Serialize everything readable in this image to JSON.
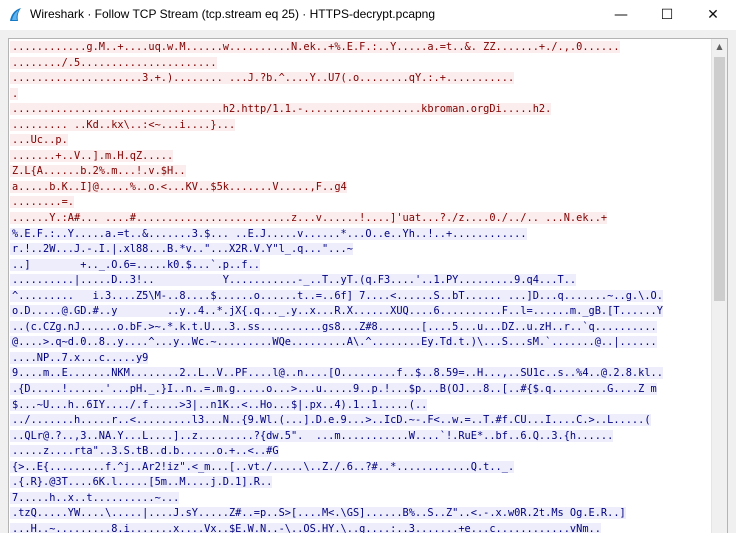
{
  "window": {
    "title": "Wireshark · Follow TCP Stream (tcp.stream eq 25) · HTTPS-decrypt.pcapng",
    "minimize_glyph": "—",
    "maximize_glyph": "☐",
    "close_glyph": "✕"
  },
  "icons": {
    "app": "wireshark-fin-icon",
    "scroll_up": "chevron-up-icon",
    "scroll_down": "chevron-down-icon"
  },
  "colors": {
    "client_text": "#7f0000",
    "client_bg": "#fbeded",
    "server_text": "#00007f",
    "server_bg": "#ededfb"
  },
  "stream": {
    "lines": [
      {
        "dir": "client",
        "text": "............g.M..+....uq.w.M......w..........N.ek..+%.E.F.:..Y.....a.=t..&. ZZ.......+./.,.0......"
      },
      {
        "dir": "client",
        "text": "......../.5......................"
      },
      {
        "dir": "client",
        "text": ".....................3.+.)........ ...J.?b.^....Y..U7(.o........qY.:.+..........."
      },
      {
        "dir": "client",
        "text": "."
      },
      {
        "dir": "client",
        "text": "..................................h2.http/1.1.-...................kbroman.orgDi.....h2."
      },
      {
        "dir": "client",
        "text": "......... ..Kd..kx\\..:<~...i....}..."
      },
      {
        "dir": "client",
        "text": "...Uc..p."
      },
      {
        "dir": "client",
        "text": ".......+..V..].m.H.qZ....."
      },
      {
        "dir": "client",
        "text": "Z.L{A......b.2%.m...!.v.$H.."
      },
      {
        "dir": "client",
        "text": "a.....b.K..I]@.....%..o.<...KV..$5k.......V.....,F..g4"
      },
      {
        "dir": "client",
        "text": "........=."
      },
      {
        "dir": "client",
        "text": "......Y.:A#... ....#.........................z...v......!....]'uat...?./z....0./../.. ...N.ek..+"
      },
      {
        "dir": "server",
        "text": "%.E.F.:..Y.....a.=t..&.......3.$... ..E.J.....v......*...O..e..Yh..!..+............"
      },
      {
        "dir": "server",
        "text": "r.!..2W...J.-.I.|.xl88...B.*v..\"...X2R.V.Y\"l_.q...\"...~"
      },
      {
        "dir": "server",
        "text": "..]        +.._.O.6=.....k0.$...`.p..f.."
      },
      {
        "dir": "server",
        "text": "..........|.....D..3!..           Y...........-_..T..yT.(q.F3....'..1.PY.........9.q4...T.."
      },
      {
        "dir": "server",
        "text": "^.........   i.3....Z5\\M-..8....$......o......t..=..6f] 7....<......S..bT...... ...]D...q.......~..g.\\.O."
      },
      {
        "dir": "server",
        "text": "o.D.....@.GD.#..y        ..y..4..*.jX{.q..._.y..x...R.X......XUQ....6..........F..l=......m._gB.[T......Y"
      },
      {
        "dir": "server",
        "text": "..(c.CZg.nJ......o.bF.>~.*.k.t.U...3..ss..........gs8...Z#8.......[....5...u...DZ..u.zH..r..`q.........."
      },
      {
        "dir": "server",
        "text": "@....>.q~d.0..8..y....^...y..Wc.~.........WQe.........A\\.^........Ey.Td.t.)\\...S...sM.`.......@..|......"
      },
      {
        "dir": "server",
        "text": "....NP..7.x...c.....y9"
      },
      {
        "dir": "server",
        "text": "9....m..E.......NKM........2..L..V..PF....l@..n....[O.........f..$..8.59=..H...,..SU1c..s..%4..@.2.8.kl.."
      },
      {
        "dir": "server",
        "text": ".{D.....!......'...pH._.}I..n..=.m.g.....o...>...u.....9..p.!...$p...B(OJ...8..[..#{$.q.........G....Z m"
      },
      {
        "dir": "server",
        "text": "$...~U...h..6IY..../.f.....>3|..n1K..<..Ho...$|.px..4).1..1.....(.."
      },
      {
        "dir": "server",
        "text": "../.......h.....r..<.........l3...N..{9.Wl.(...].D.e.9...>..IcD.~-.F<..w.=..T.#f.CU...I....C.>..L.....("
      },
      {
        "dir": "server",
        "text": "..QLr@.?..,3..NA.Y...L....]..z.........?{dw.5\".  ...m...........W....`!.RuE*..bf..6.Q..3.{h......"
      },
      {
        "dir": "server",
        "text": ".....z....rta\"..3.S.tB..d.b......o.+..<..#G"
      },
      {
        "dir": "server",
        "text": "{>..E{.........f.^j..Ar2!iz\".<_m...[..vt./.....\\..Z./.6..?#..*............Q.t.._."
      },
      {
        "dir": "server",
        "text": ".{.R}.@3T....6K.l.....[5m..M....j.D.1].R.."
      },
      {
        "dir": "server",
        "text": "7.....h..x..t..........~..."
      },
      {
        "dir": "server",
        "text": ".tzQ.....YW....\\.....|....J.sY.....Z#..=p..S>[....M<.\\GS]......B%..S..Z\"..<.-.x.w0R.2t.Ms Og.E.R..]"
      },
      {
        "dir": "server",
        "text": "...H..~.........8.i.......x....Vx..$E.W.N..-\\..OS.HY.\\..g....:..3.......+e...c............vNm.."
      }
    ]
  }
}
